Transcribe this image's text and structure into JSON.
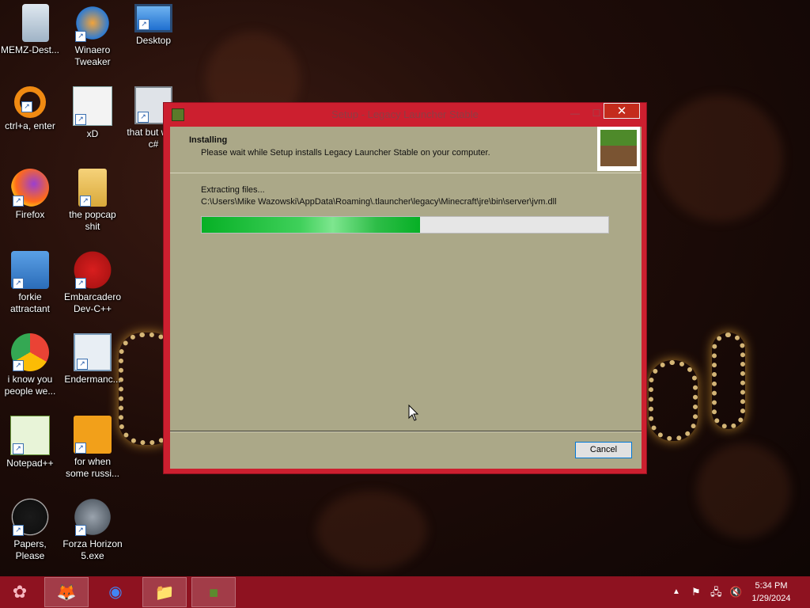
{
  "desktop": {
    "icons": [
      {
        "label": "MEMZ-Dest...",
        "icon": "recycle-bin-icon"
      },
      {
        "label": "Winaero Tweaker",
        "icon": "winaero-icon"
      },
      {
        "label": "Desktop",
        "icon": "monitor-icon"
      },
      {
        "label": "ctrl+a, enter",
        "icon": "orange-ring-icon"
      },
      {
        "label": "xD",
        "icon": "hxd-icon"
      },
      {
        "label": "that but w its c#",
        "icon": "windows-stack-icon"
      },
      {
        "label": "Firefox",
        "icon": "firefox-icon"
      },
      {
        "label": "the popcap shit",
        "icon": "folder-icon"
      },
      {
        "label": "forkie attractant",
        "icon": "computer-gear-icon"
      },
      {
        "label": "Embarcadero Dev-C++",
        "icon": "devcpp-icon"
      },
      {
        "label": "i know you people we...",
        "icon": "chrome-icon"
      },
      {
        "label": "Endermanc...",
        "icon": "window-app-icon"
      },
      {
        "label": "Notepad++",
        "icon": "notepadpp-icon"
      },
      {
        "label": "for when some russi...",
        "icon": "de-icon"
      },
      {
        "label": "Papers, Please",
        "icon": "papers-please-icon"
      },
      {
        "label": "Forza Horizon 5.exe",
        "icon": "flash-icon"
      }
    ]
  },
  "dialog": {
    "title": "Setup - Legacy Launcher Stable",
    "close_glyph": "✕",
    "min_glyph": "—",
    "max_glyph": "☐",
    "header_title": "Installing",
    "header_subtitle": "Please wait while Setup installs Legacy Launcher Stable on your computer.",
    "status": "Extracting files...",
    "path": "C:\\Users\\Mike Wazowski\\AppData\\Roaming\\.tlauncher\\legacy\\Minecraft\\jre\\bin\\server\\jvm.dll",
    "progress": 0.537,
    "cancel_label": "Cancel"
  },
  "taskbar": {
    "apps": [
      {
        "name": "firefox-icon",
        "glyph": "🦊",
        "active": true
      },
      {
        "name": "chrome-icon",
        "glyph": "◉",
        "active": false
      },
      {
        "name": "file-explorer-icon",
        "glyph": "📁",
        "active": true
      },
      {
        "name": "minecraft-installer-icon",
        "glyph": "■",
        "active": true
      }
    ],
    "time": "5:34 PM",
    "date": "1/29/2024"
  }
}
